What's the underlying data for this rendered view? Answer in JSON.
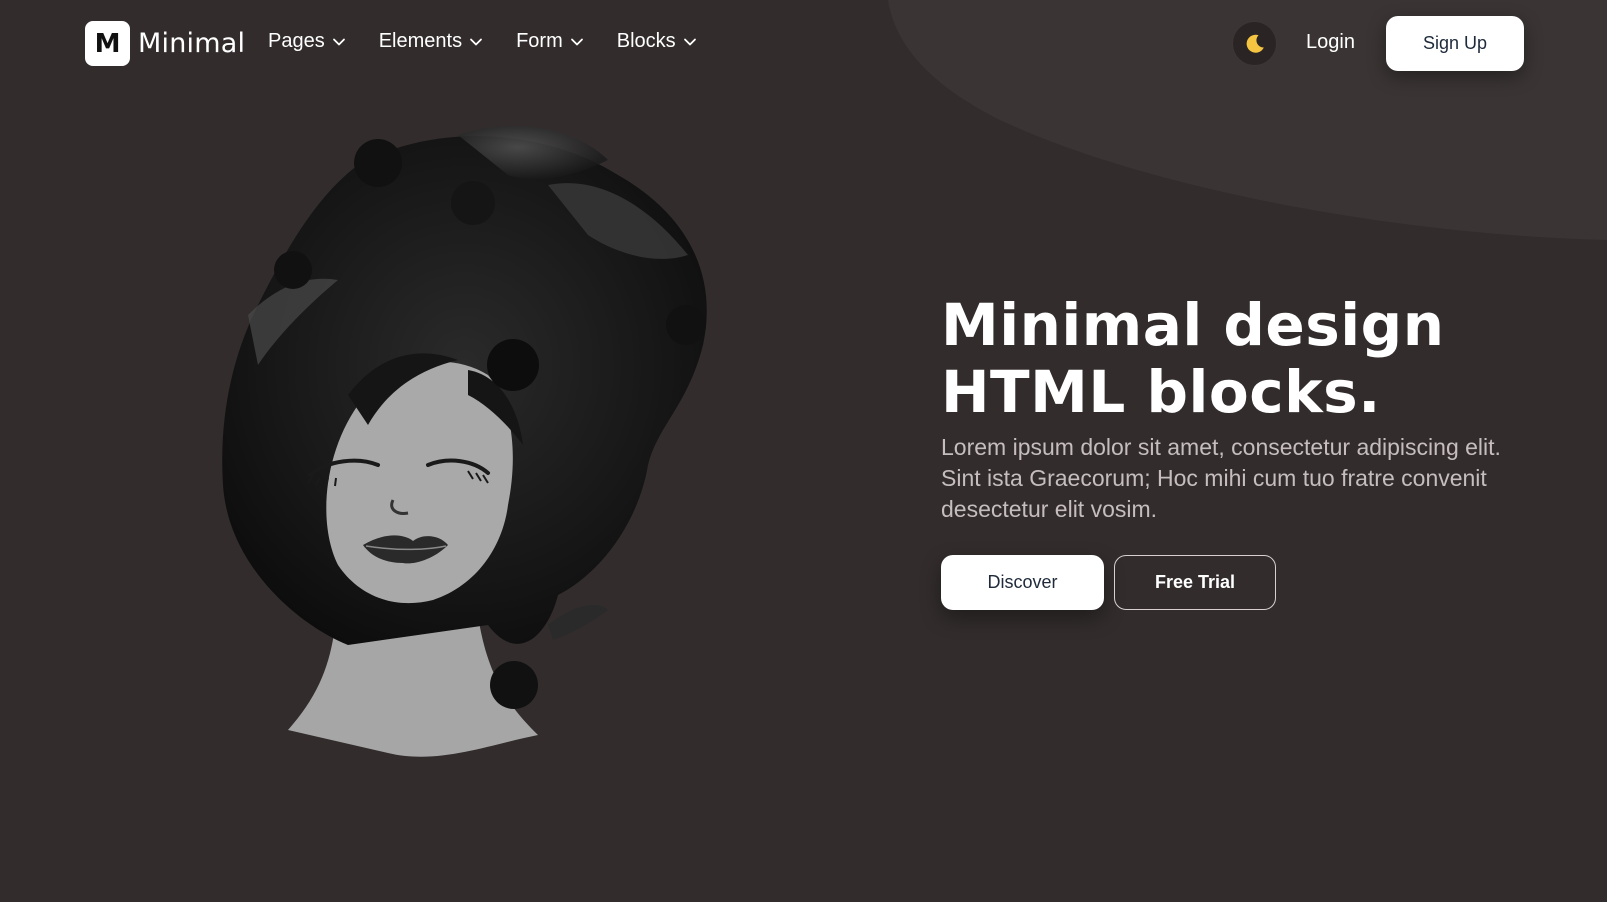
{
  "brand": {
    "logo_letter": "M",
    "name": "Minimal"
  },
  "nav": {
    "items": [
      {
        "label": "Pages"
      },
      {
        "label": "Elements"
      },
      {
        "label": "Form"
      },
      {
        "label": "Blocks"
      }
    ],
    "theme_icon": "moon-icon",
    "login_label": "Login",
    "signup_label": "Sign Up"
  },
  "hero": {
    "title_line1": "Minimal design",
    "title_line2": "HTML blocks.",
    "description": "Lorem ipsum dolor sit amet, consectetur adipiscing elit. Sint ista Graecorum; Hoc mihi cum tuo fratre convenit desectetur elit vosim.",
    "primary_cta": "Discover",
    "secondary_cta": "Free Trial",
    "illustration": "watercolor-woman-portrait"
  },
  "colors": {
    "background": "#322c2c",
    "accent_blob": "#3a3434",
    "moon": "#f5c542",
    "button_text": "#1e2a3a"
  }
}
